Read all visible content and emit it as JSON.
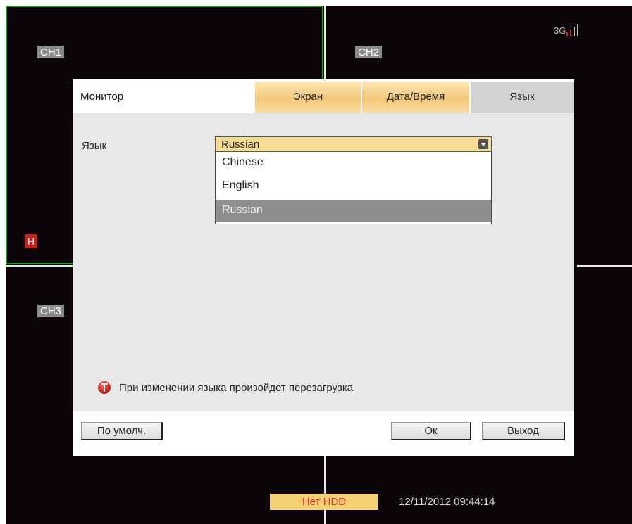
{
  "screen": {
    "channels": [
      {
        "label": "CH1"
      },
      {
        "label": "CH2"
      },
      {
        "label": "CH3"
      }
    ],
    "record_badge": "H",
    "signal_label": "3G",
    "hdd_status": "Нет HDD",
    "datetime": "12/11/2012 09:44:14",
    "colors": {
      "active_channel_border": "#1e9a1e",
      "background": "#0b050a",
      "hdd_text": "#d83030",
      "hdd_bg": "#f4d073"
    }
  },
  "dialog": {
    "title": "Монитор",
    "tabs": [
      {
        "label": "Экран",
        "state": "inactive"
      },
      {
        "label": "Дата/Время",
        "state": "inactive"
      },
      {
        "label": "Язык",
        "state": "active"
      }
    ],
    "language": {
      "label": "Язык",
      "selected": "Russian",
      "options": [
        "Chinese",
        "English",
        "Russian"
      ],
      "highlighted_option": "Russian"
    },
    "warning": {
      "icon": "alert-icon",
      "text": "При изменении языка произойдет перезагрузка"
    },
    "buttons": {
      "default": "По умолч.",
      "ok": "Ок",
      "exit": "Выход"
    }
  }
}
